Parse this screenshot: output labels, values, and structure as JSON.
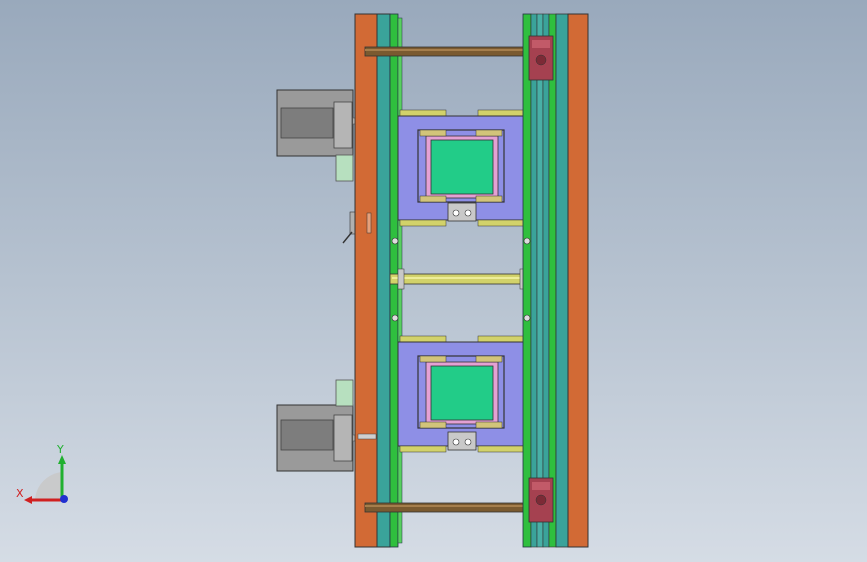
{
  "view": {
    "background_top": "#99a9bc",
    "background_bottom": "#d5dce5"
  },
  "colors": {
    "plate_orange": "#d26a35",
    "plate_teal": "#3aa39a",
    "plate_green": "#2fbf3e",
    "cavity_blue": "#8e8fe6",
    "insert_green": "#22cc88",
    "insert_pink": "#e4a1d4",
    "pin_brown": "#7a5a30",
    "pin_yellow": "#d2d26a",
    "motor_gray": "#9c9c9c",
    "bracket_mint": "#b7e0bf",
    "lock_red": "#a54150"
  },
  "triad": {
    "x_label": "X",
    "y_label": "Y",
    "x_color": "#d02020",
    "y_color": "#20b030",
    "z_color": "#2030d0"
  }
}
